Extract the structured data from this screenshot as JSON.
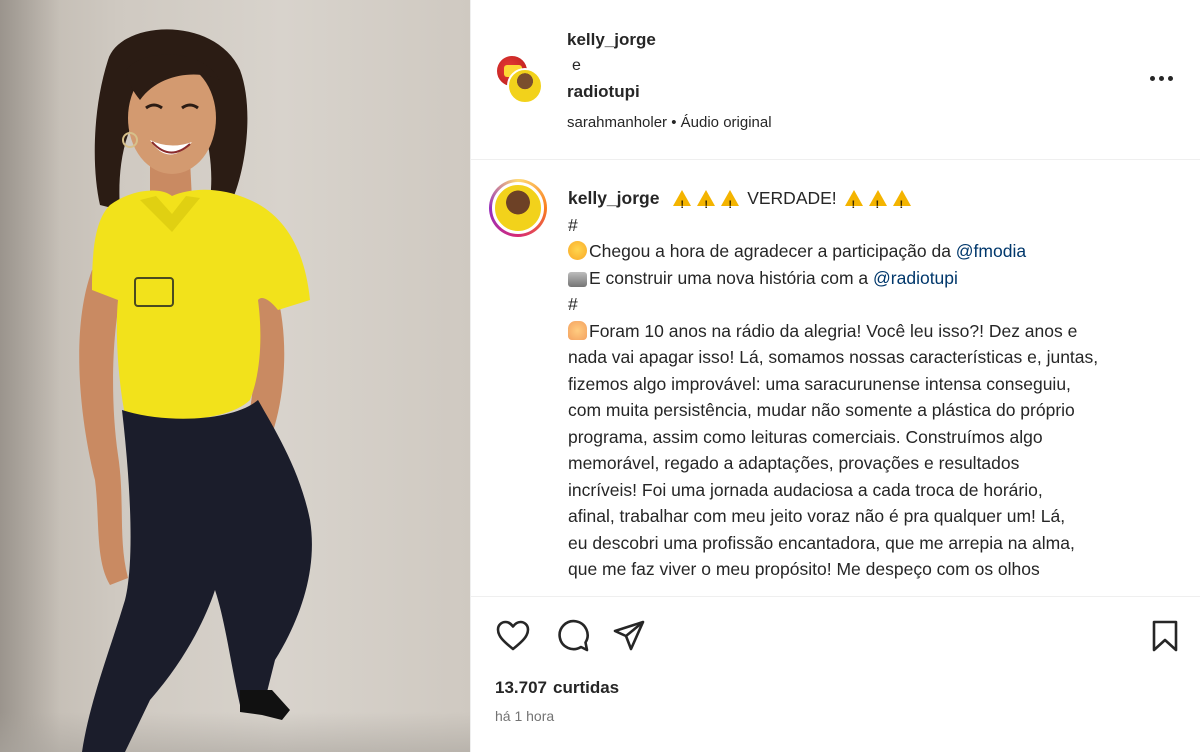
{
  "post": {
    "authors": [
      "kelly_jorge",
      "radiotupi"
    ],
    "author_joiner": "e",
    "audio": {
      "creator": "sarahmanholer",
      "separator": " • ",
      "label": "Áudio original"
    }
  },
  "caption": {
    "username": "kelly_jorge",
    "headline": "VERDADE!",
    "hash_line": "#",
    "line_thanks": "Chegou a hora de agradecer a participação da ",
    "mention_fmodia": "@fmodia",
    "line_new": "E construir uma nova história com a ",
    "mention_radiotupi": "@radiotupi",
    "body_lines": [
      "Foram 10 anos na rádio da alegria! Você leu isso?! Dez anos e",
      "nada vai apagar isso! Lá, somamos nossas características e, juntas,",
      "fizemos algo improvável: uma saracurunense intensa conseguiu,",
      "com muita persistência, mudar não somente a plástica do próprio",
      "programa, assim como leituras comerciais. Construímos algo",
      "memorável, regado a adaptações, provações e resultados",
      "incríveis! Foi uma jornada audaciosa a cada troca de horário,",
      "afinal, trabalhar com meu jeito voraz não é pra qualquer um! Lá,",
      "eu descobri uma profissão encantadora, que me arrepia na alma,",
      "que me faz viver o meu propósito! Me despeço com os olhos"
    ]
  },
  "engagement": {
    "likes_count": "13.707",
    "likes_label": "curtidas",
    "time_ago": "há 1 hora"
  },
  "icons": {
    "like": "heart-icon",
    "comment": "comment-icon",
    "share": "share-icon",
    "save": "bookmark-icon",
    "more": "more-options-icon",
    "warning": "warning-emoji-icon"
  },
  "colors": {
    "text": "#262626",
    "mention": "#00376b",
    "muted": "#737373",
    "shirt": "#f2e21b",
    "pants": "#1b1d2b"
  }
}
